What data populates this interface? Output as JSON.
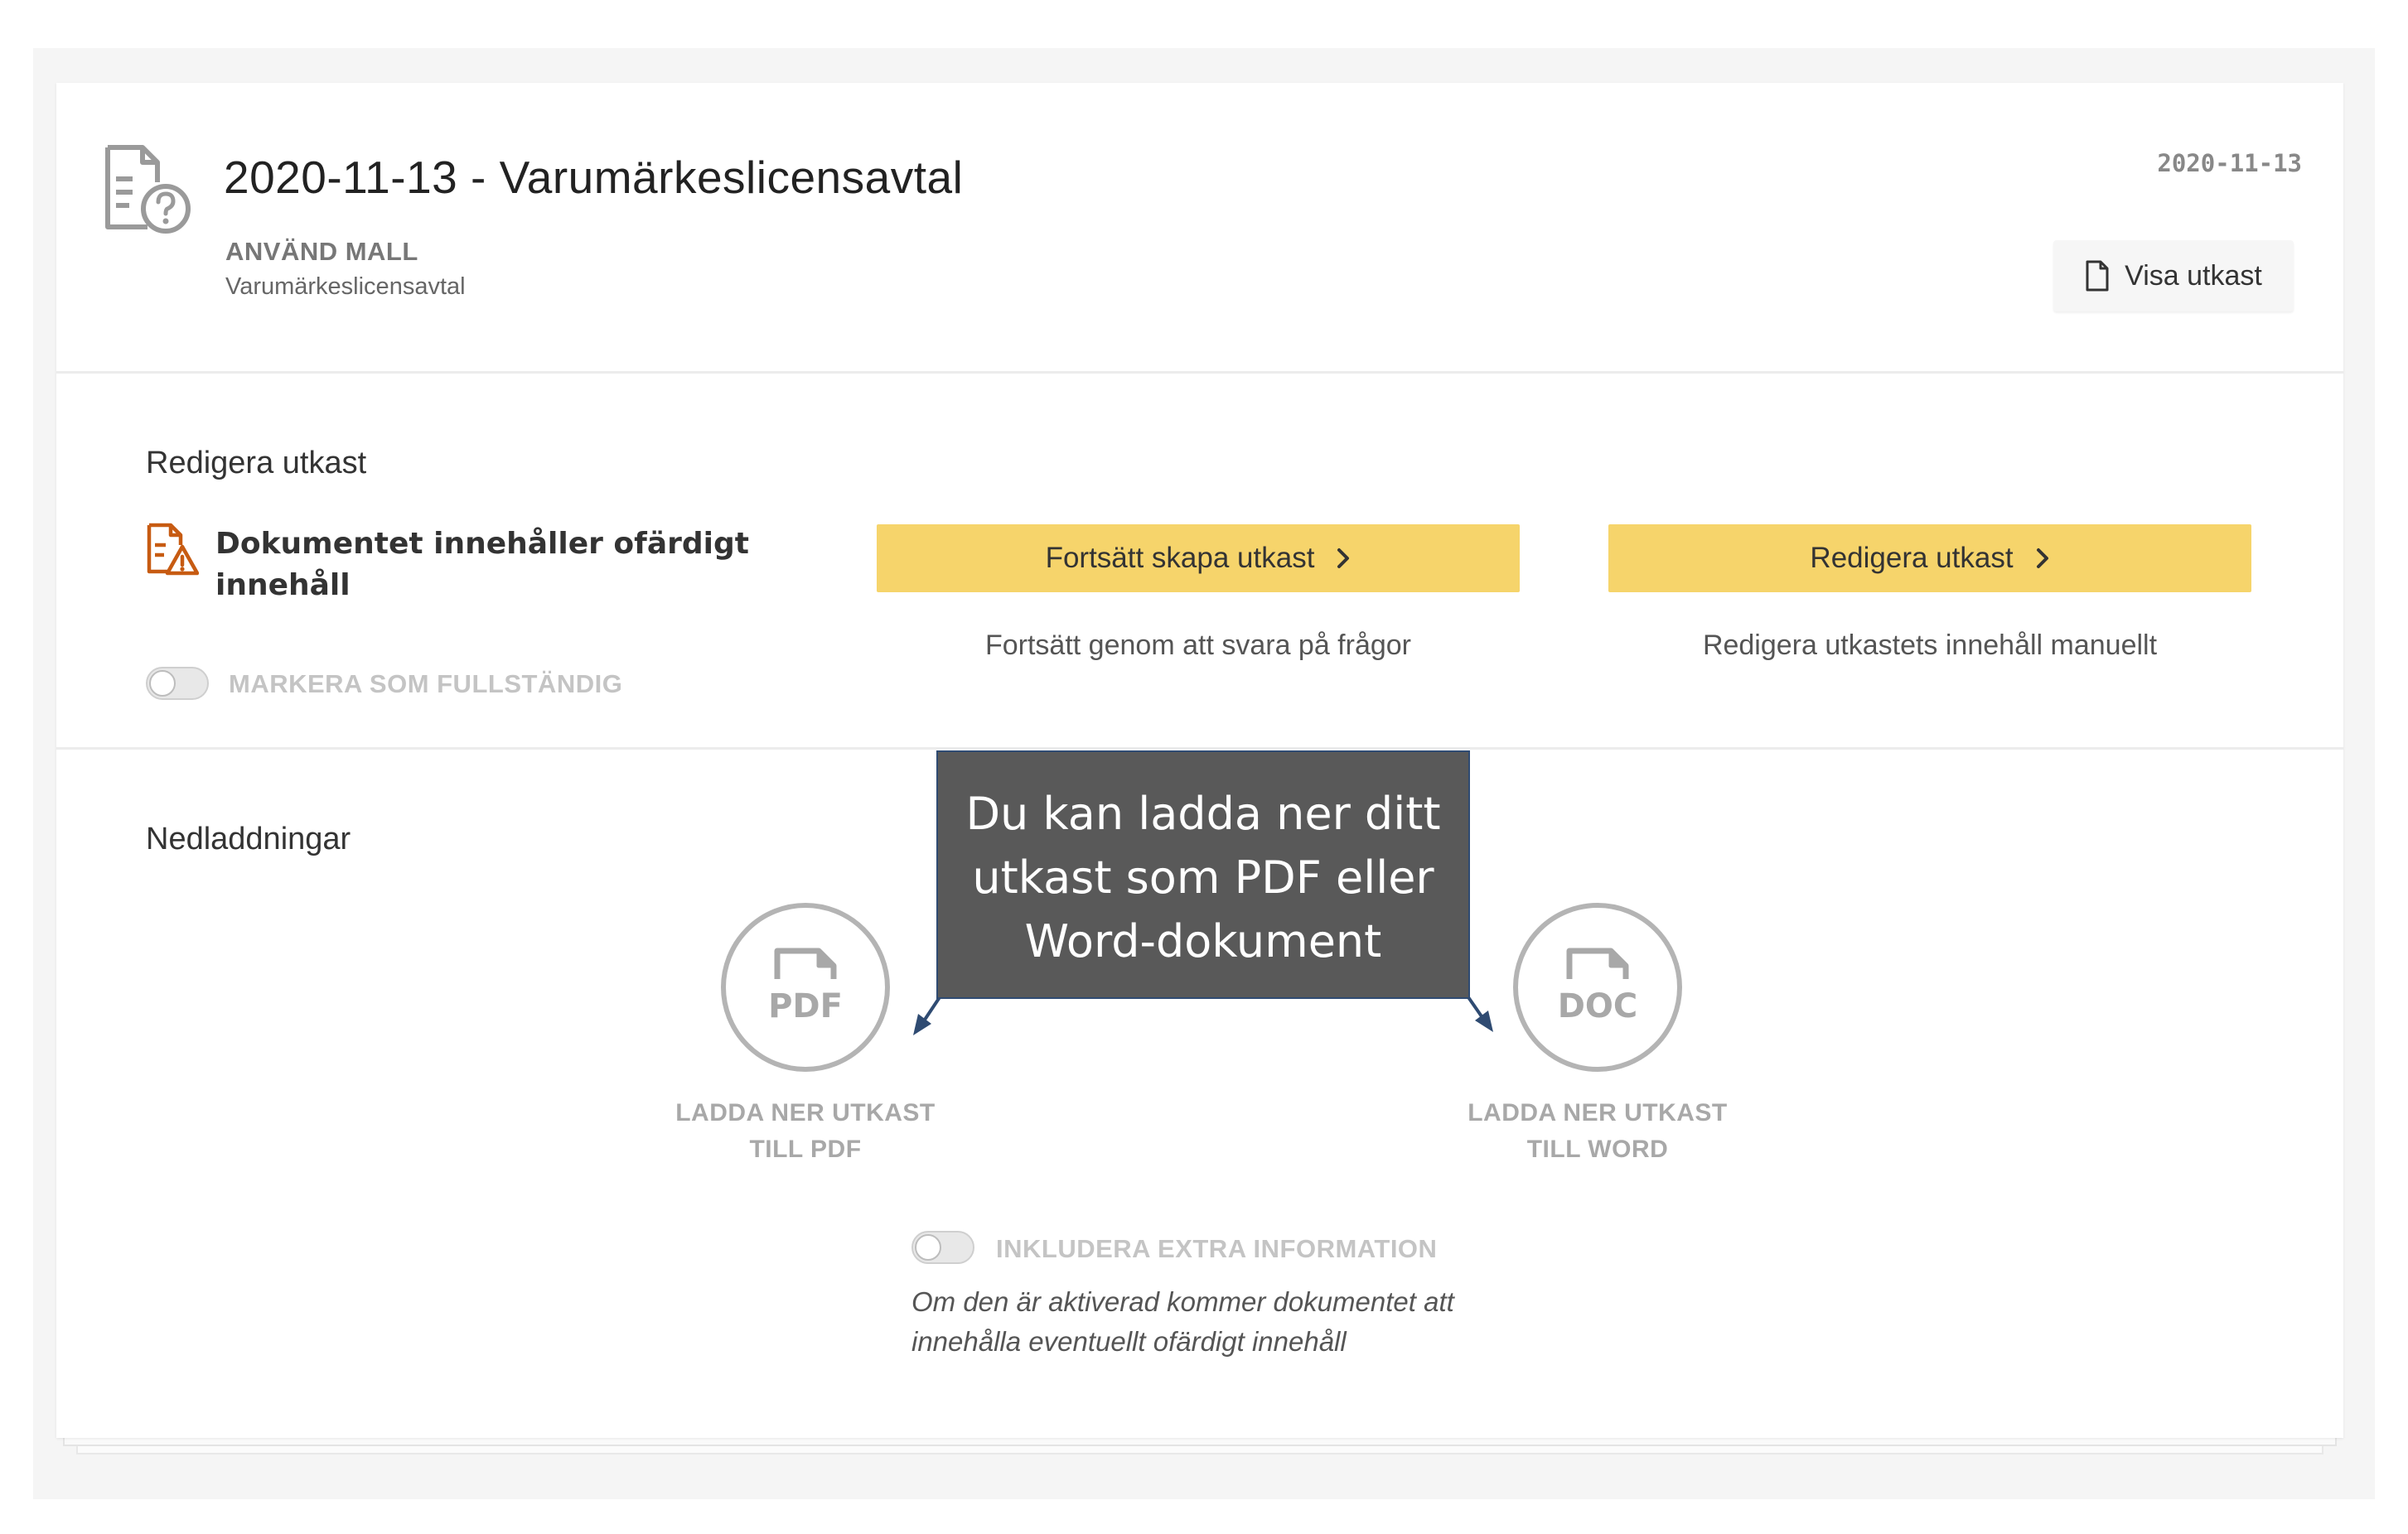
{
  "header": {
    "title": "2020-11-13 - Varumärkeslicensavtal",
    "template_label": "ANVÄND MALL",
    "template_name": "Varumärkeslicensavtal",
    "date": "2020-11-13",
    "view_draft_label": "Visa utkast"
  },
  "edit_section": {
    "title": "Redigera utkast",
    "warning_text": "Dokumentet innehåller ofärdigt innehåll",
    "mark_complete_label": "MARKERA SOM FULLSTÄNDIG",
    "mark_complete_on": false,
    "continue_button_label": "Fortsätt skapa utkast",
    "continue_help": "Fortsätt genom att svara på frågor",
    "edit_button_label": "Redigera utkast",
    "edit_help": "Redigera utkastets innehåll manuellt"
  },
  "downloads": {
    "title": "Nedladdningar",
    "pdf_icon_text": "PDF",
    "pdf_label_line1": "LADDA NER UTKAST",
    "pdf_label_line2": "TILL PDF",
    "doc_icon_text": "DOC",
    "doc_label_line1": "LADDA NER UTKAST",
    "doc_label_line2": "TILL WORD",
    "extra_info_label": "INKLUDERA EXTRA INFORMATION",
    "extra_info_on": false,
    "extra_info_desc_line1": "Om den är aktiverad kommer dokumentet att",
    "extra_info_desc_line2": "innehålla eventuellt ofärdigt innehåll"
  },
  "callout": {
    "line1": "Du kan ladda ner ditt",
    "line2": "utkast som PDF eller",
    "line3": "Word-dokument"
  },
  "colors": {
    "primary_button": "#f6d46b",
    "warning_icon": "#c75b12",
    "callout_background": "#595959",
    "callout_border": "#2f4b72"
  }
}
